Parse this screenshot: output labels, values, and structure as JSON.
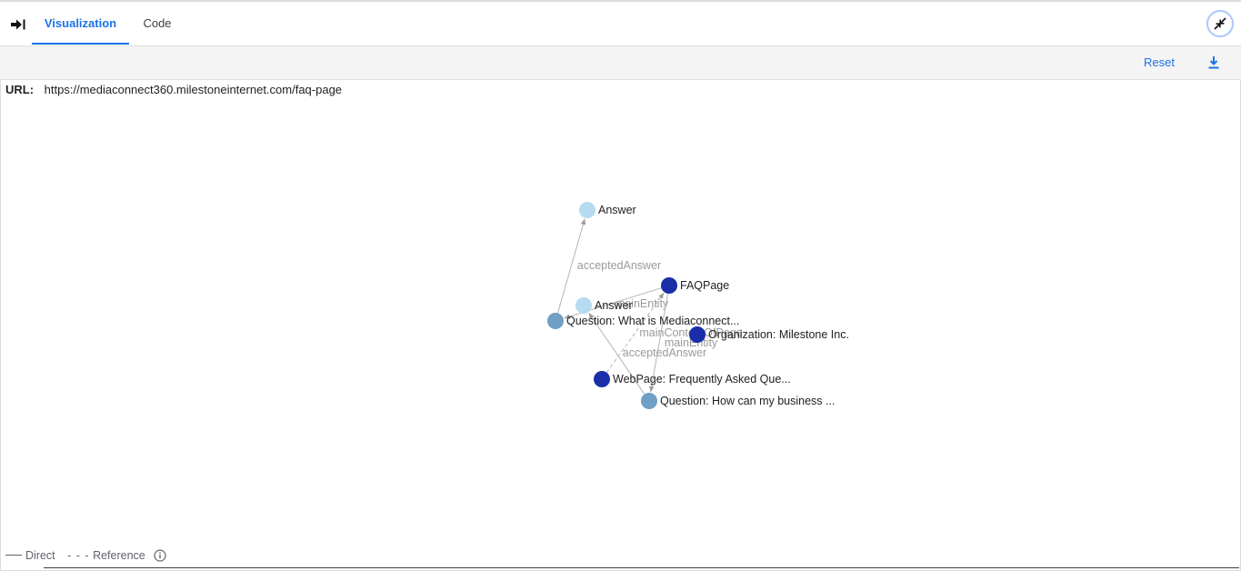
{
  "tabs": [
    {
      "label": "Visualization",
      "active": true
    },
    {
      "label": "Code",
      "active": false
    }
  ],
  "toolbar": {
    "reset_label": "Reset"
  },
  "url": {
    "label": "URL:",
    "value": "https://mediaconnect360.milestoneinternet.com/faq-page"
  },
  "graph": {
    "nodes": [
      {
        "id": "answer1",
        "label": "Answer",
        "color": "#b6daf0"
      },
      {
        "id": "faqpage",
        "label": "FAQPage",
        "color": "#1a2ea8"
      },
      {
        "id": "answer2",
        "label": "Answer",
        "color": "#b6daf0"
      },
      {
        "id": "question1",
        "label": "Question: What is Mediaconnect...",
        "color": "#6f9fc4"
      },
      {
        "id": "organization",
        "label": "Organization: Milestone Inc.",
        "color": "#1a2ea8"
      },
      {
        "id": "webpage",
        "label": "WebPage: Frequently Asked Que...",
        "color": "#1a2ea8"
      },
      {
        "id": "question2",
        "label": "Question: How can my business ...",
        "color": "#6f9fc4"
      }
    ],
    "edges": [
      {
        "from": "question1",
        "to": "answer1",
        "label": "acceptedAnswer",
        "type": "direct"
      },
      {
        "from": "faqpage",
        "to": "question1",
        "label": "mainEntity",
        "type": "direct"
      },
      {
        "from": "faqpage",
        "to": "question2",
        "label": "mainEntity",
        "type": "direct"
      },
      {
        "from": "question2",
        "to": "answer2",
        "label": "acceptedAnswer",
        "type": "direct"
      },
      {
        "from": "webpage",
        "to": "faqpage",
        "label": "mainContentOfPage",
        "type": "reference"
      }
    ]
  },
  "legend": {
    "direct_label": "Direct",
    "reference_label": "Reference",
    "reference_dashes": "- - -"
  },
  "colors": {
    "accent": "#1a73e8"
  },
  "icons": {
    "collapse": "arrow-right-bar-icon",
    "fullscreen_exit": "fullscreen-exit-icon",
    "download": "download-icon",
    "info": "info-icon"
  }
}
